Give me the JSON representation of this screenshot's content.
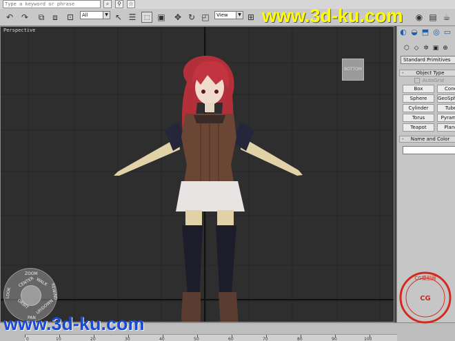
{
  "search": {
    "placeholder": "Type a keyword or phrase"
  },
  "toolbar": {
    "selection_filter": "All",
    "reference_coord": "View"
  },
  "viewport": {
    "label": "Perspective",
    "viewcube_face": "BOTTOM",
    "nav_wheel": {
      "zoom": "ZOOM",
      "center": "CENTER",
      "walk": "WALK",
      "rewind": "REWIND",
      "orbit": "ORBIT",
      "pan": "PAN",
      "look": "LOOK",
      "up_down": "UP/DOWN"
    }
  },
  "command_panel": {
    "category": "Standard Primitives",
    "object_type_title": "Object Type",
    "autogrid_label": "AutoGrid",
    "primitives": [
      "Box",
      "Cone",
      "Sphere",
      "GeoSphere",
      "Cylinder",
      "Tube",
      "Torus",
      "Pyramid",
      "Teapot",
      "Plane"
    ],
    "name_color_title": "Name and Color"
  },
  "timeline": {
    "ticks": [
      "0",
      "10",
      "20",
      "30",
      "40",
      "50",
      "60",
      "70",
      "80",
      "90",
      "100"
    ]
  },
  "watermark": {
    "top": "www.3d-ku.com",
    "bottom": "www.3d-ku.com",
    "stamp_text": "CG模型网",
    "stamp_sub": "CG"
  },
  "colors": {
    "watermark_top": "#ffff00",
    "watermark_bottom": "#1a49d4",
    "stamp_red": "#d22a1e",
    "viewport_bg": "#2e2e2e"
  }
}
